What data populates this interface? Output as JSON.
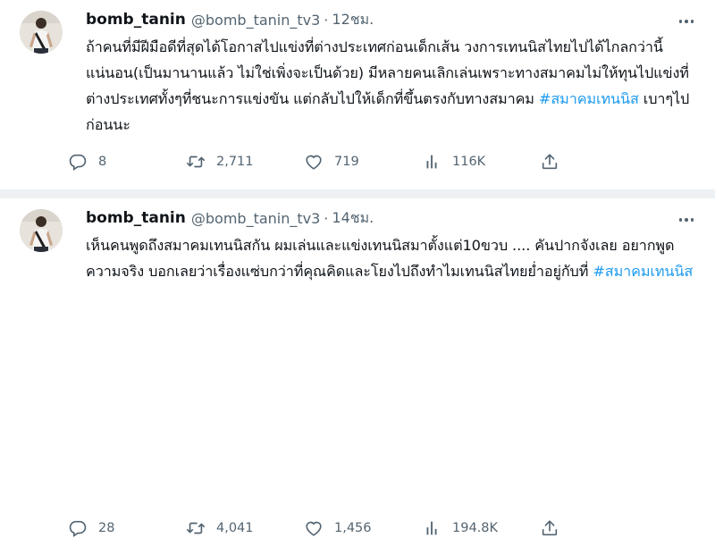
{
  "tweets": [
    {
      "name": "bomb_tanin",
      "handle": "@bomb_tanin_tv3",
      "separator": "·",
      "time": "12ชม.",
      "text_before": "ถ้าคนที่มีฝีมือดีที่สุดได้โอกาสไปแข่งที่ต่างประเทศก่อนเด็กเส้น วงการเทนนิสไทยไปได้ไกลกว่านี้แน่นอน(เป็นมานานแล้ว ไม่ใช่เพิ่งจะเป็นด้วย) มีหลายคนเลิกเล่นเพราะทางสมาคมไม่ให้ทุนไปแข่งที่ต่างประเทศทั้งๆที่ชนะการแข่งขัน แต่กลับไปให้เด็กที่ขึ้นตรงกับทางสมาคม ",
      "hashtag": "#สมาคมเทนนิส",
      "text_after": " เบาๆไปก่อนนะ",
      "replies": "8",
      "retweets": "2,711",
      "likes": "719",
      "views": "116K"
    },
    {
      "name": "bomb_tanin",
      "handle": "@bomb_tanin_tv3",
      "separator": "·",
      "time": "14ชม.",
      "text_before": "เห็นคนพูดถึงสมาคมเทนนิสกัน ผมเล่นและแข่งเทนนิสมาตั้งแต่10ขวบ .... คันปากจังเลย อยากพูดความจริง บอกเลยว่าเรื่องแซ่บกว่าที่คุณคิดและโยงไปถึงทำไมเทนนิสไทยย่ำอยู่กับที่ ",
      "hashtag": "#สมาคมเทนนิส",
      "text_after": "",
      "replies": "28",
      "retweets": "4,041",
      "likes": "1,456",
      "views": "194.8K"
    }
  ],
  "colors": {
    "accent": "#1d9bf0",
    "muted": "#536471",
    "text": "#0f1419",
    "separator": "#eef1f3"
  },
  "icons": [
    "reply-icon",
    "retweet-icon",
    "like-icon",
    "views-icon",
    "share-icon",
    "more-icon"
  ]
}
